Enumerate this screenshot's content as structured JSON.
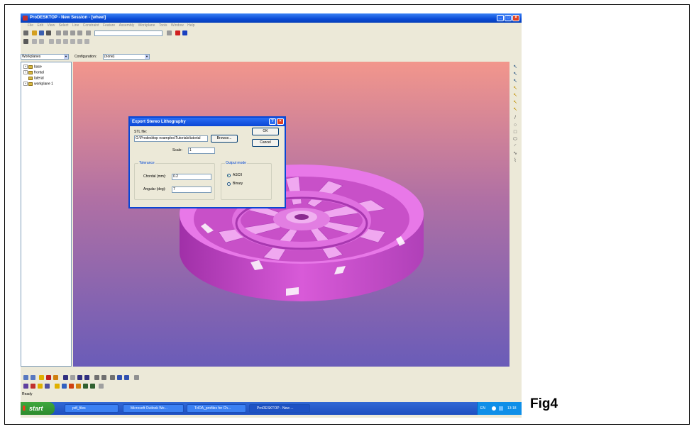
{
  "window": {
    "title": "ProDESKTOP - New Session - [wheel]",
    "controls": {
      "minimize_glyph": "_",
      "maximize_glyph": "□",
      "close_glyph": "×"
    }
  },
  "menu": [
    "File",
    "Edit",
    "View",
    "Select",
    "Line",
    "Constraint",
    "Feature",
    "Assembly",
    "Workplane",
    "Tools",
    "Window",
    "Help"
  ],
  "toolbar_row2": {
    "combo_value": ""
  },
  "selectors": {
    "workplanes_value": "Workplanes",
    "configuration_label": "Configuration:",
    "configuration_value": "(none)"
  },
  "tree": {
    "items": [
      {
        "label": "base"
      },
      {
        "label": "frontal"
      },
      {
        "label": "lateral"
      },
      {
        "label": "workplane 1"
      }
    ]
  },
  "dialog": {
    "title": "Export Stereo Lithography",
    "help_glyph": "?",
    "close_glyph": "×",
    "stl_file_label": "STL file:",
    "stl_file_value": "G:\\Prodesktop examples\\Tutorials\\tutorial",
    "browse_label": "Browse...",
    "ok_label": "OK",
    "cancel_label": "Cancel",
    "scale_label": "Scale:",
    "scale_value": "1",
    "tolerance_group": "Tolerance",
    "chordal_label": "Chordal (mm):",
    "chordal_value": "0.2",
    "angular_label": "Angular (deg):",
    "angular_value": "7",
    "output_mode_group": "Output mode",
    "ascii_label": "ASCII",
    "binary_label": "Binary",
    "selected_mode": "ASCII"
  },
  "status_text": "Ready",
  "taskbar": {
    "start_label": "start",
    "tasks": [
      {
        "label": "pdf_files"
      },
      {
        "label": "Microsoft Outlook We..."
      },
      {
        "label": "TdOA_profiles for Ch..."
      },
      {
        "label": "ProDESKTOP - New ..."
      }
    ],
    "tray_lang": "EN",
    "tray_time": "13:18"
  },
  "caption": "Fig4",
  "colors": {
    "viewport_top": "#f2968c",
    "viewport_bottom": "#6a5cb8",
    "model": "#e070e0",
    "titlebar": "#0a4ad6",
    "start_green": "#2d8b2d"
  }
}
